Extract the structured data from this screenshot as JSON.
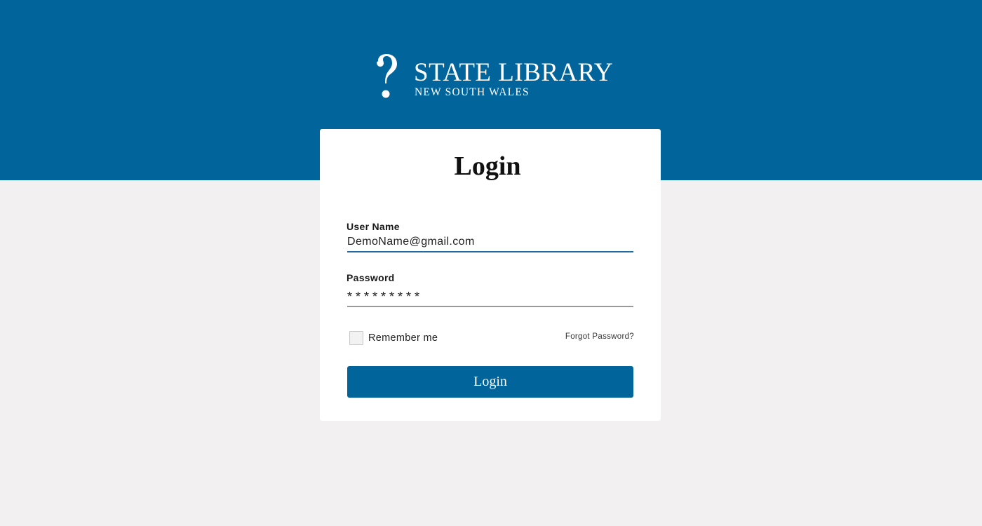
{
  "brand": {
    "title": "STATE LIBRARY",
    "subtitle": "NEW SOUTH WALES",
    "logo_icon": "question-mark-icon"
  },
  "login_form": {
    "title": "Login",
    "username": {
      "label": "User Name",
      "value": "DemoName@gmail.com"
    },
    "password": {
      "label": "Password",
      "value": "*********"
    },
    "remember_me_label": "Remember me",
    "remember_me_checked": false,
    "forgot_password_label": "Forgot Password?",
    "submit_label": "Login"
  },
  "colors": {
    "brand_blue": "#01659b",
    "page_background": "#f2f0f1",
    "card_background": "#ffffff"
  }
}
